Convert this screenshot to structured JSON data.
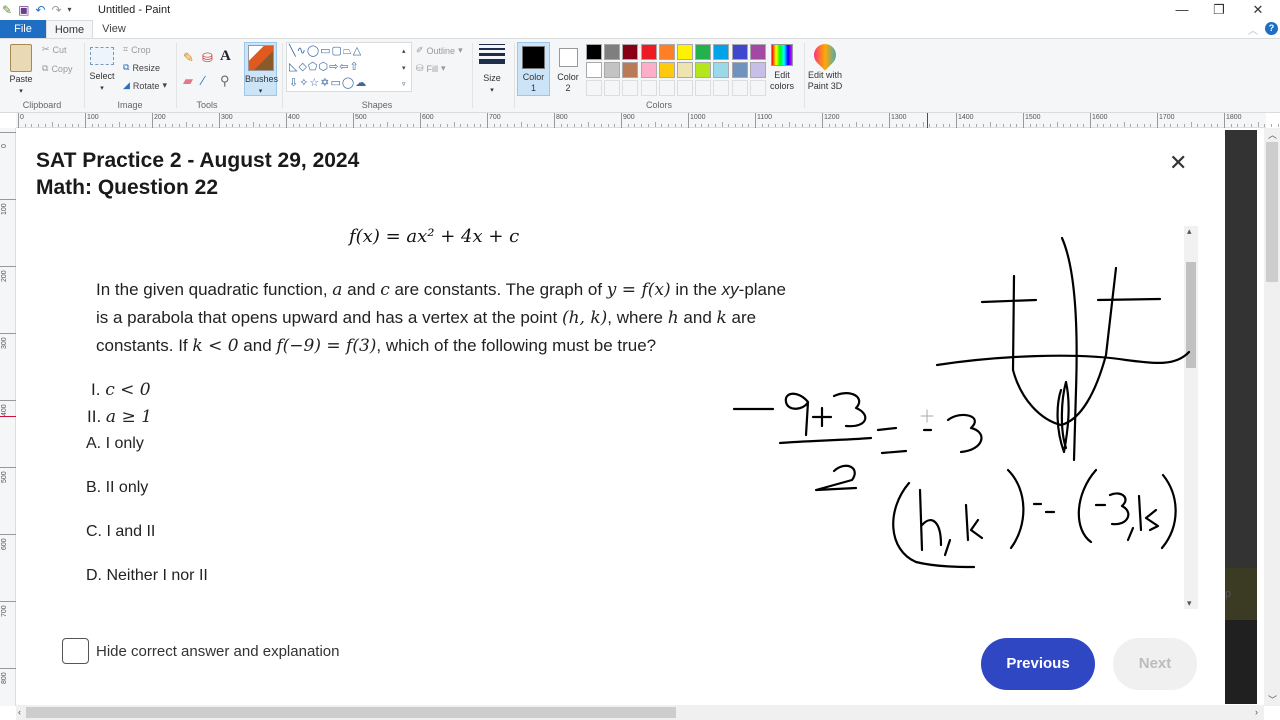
{
  "window": {
    "title": "Untitled - Paint",
    "controls": {
      "minimize": "—",
      "restore": "❐",
      "close": "✕"
    }
  },
  "quick_access": {
    "icons": [
      "paint-app-icon",
      "save-icon",
      "undo-icon",
      "redo-icon",
      "customize-icon"
    ]
  },
  "tabs": [
    {
      "label": "File",
      "active": false
    },
    {
      "label": "Home",
      "active": true
    },
    {
      "label": "View",
      "active": false
    }
  ],
  "ribbon": {
    "clipboard": {
      "label": "Clipboard",
      "paste": "Paste",
      "cut": "Cut",
      "copy": "Copy"
    },
    "image": {
      "label": "Image",
      "select": "Select",
      "crop": "Crop",
      "resize": "Resize",
      "rotate": "Rotate"
    },
    "tools": {
      "label": "Tools"
    },
    "brushes": {
      "label": "Brushes"
    },
    "shapes": {
      "label": "Shapes",
      "outline": "Outline",
      "fill": "Fill"
    },
    "size": {
      "label": "Size"
    },
    "colors": {
      "label": "Colors",
      "color1_label": "Color",
      "color1_num": "1",
      "color2_label": "Color",
      "color2_num": "2",
      "color1": "#000000",
      "color2": "#ffffff",
      "palette_row1": [
        "#000000",
        "#7f7f7f",
        "#880015",
        "#ed1c24",
        "#ff7f27",
        "#fff200",
        "#22b14c",
        "#00a2e8",
        "#3f48cc",
        "#a349a4"
      ],
      "palette_row2": [
        "#ffffff",
        "#c3c3c3",
        "#b97a57",
        "#ffaec9",
        "#ffc90e",
        "#efe4b0",
        "#b5e61d",
        "#99d9ea",
        "#7092be",
        "#c8bfe7"
      ],
      "edit_colors": "Edit colors"
    },
    "paint3d": "Edit with Paint 3D"
  },
  "rulers": {
    "horizontal": [
      "0",
      "100",
      "200",
      "300",
      "400",
      "500",
      "600",
      "700",
      "800",
      "900",
      "1000",
      "1100",
      "1200",
      "1300",
      "1400",
      "1500",
      "1600",
      "1700",
      "1800"
    ],
    "vertical": [
      "0",
      "100",
      "200",
      "300",
      "400",
      "500",
      "600",
      "700",
      "800"
    ]
  },
  "question": {
    "title_line1": "SAT Practice 2 - August 29, 2024",
    "title_line2": "Math: Question 22",
    "formula": "f(x) = ax² + 4x + c",
    "para": {
      "t1": "In the given quadratic function, ",
      "a": "a",
      "t2": " and ",
      "c": "c",
      "t3": " are constants. The graph of ",
      "yfx": "y = f(x)",
      "t4": " in the ",
      "xy": "xy",
      "t5": "-plane is a parabola that opens upward and has a vertex at the point ",
      "hk": "(h, k)",
      "t6": ", where ",
      "h": "h",
      "t7": " and ",
      "k": "k",
      "t8": " are constants. If ",
      "klt": "k < 0",
      "t9": " and ",
      "feq": "f(−9) = f(3)",
      "t10": ", which of the following must be true?"
    },
    "statements": [
      {
        "num": "I.",
        "expr": "c < 0"
      },
      {
        "num": "II.",
        "expr": "a ≥ 1"
      }
    ],
    "options": [
      {
        "letter": "A.",
        "text": "I only"
      },
      {
        "letter": "B.",
        "text": "II only"
      },
      {
        "letter": "C.",
        "text": "I and II"
      },
      {
        "letter": "D.",
        "text": "Neither I nor II"
      }
    ],
    "hide_answer_label": "Hide correct answer and explanation",
    "hide_answer_checked": false,
    "previous": "Previous",
    "next": "Next",
    "close": "✕"
  },
  "sidebar_snippet": "p"
}
